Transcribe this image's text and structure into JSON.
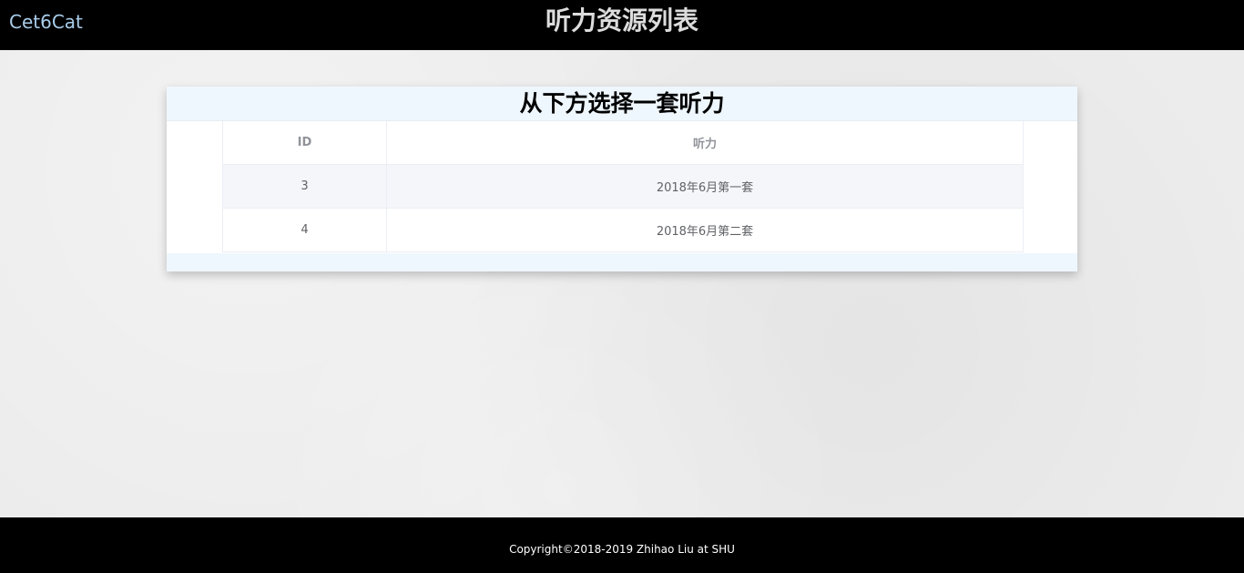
{
  "header": {
    "brand": "Cet6Cat",
    "title": "听力资源列表"
  },
  "card": {
    "title": "从下方选择一套听力"
  },
  "table": {
    "columns": [
      "ID",
      "听力"
    ],
    "rows": [
      {
        "id": "3",
        "name": "2018年6月第一套"
      },
      {
        "id": "4",
        "name": "2018年6月第二套"
      }
    ]
  },
  "footer": {
    "copyright": "Copyright©2018-2019 Zhihao Liu at SHU"
  }
}
